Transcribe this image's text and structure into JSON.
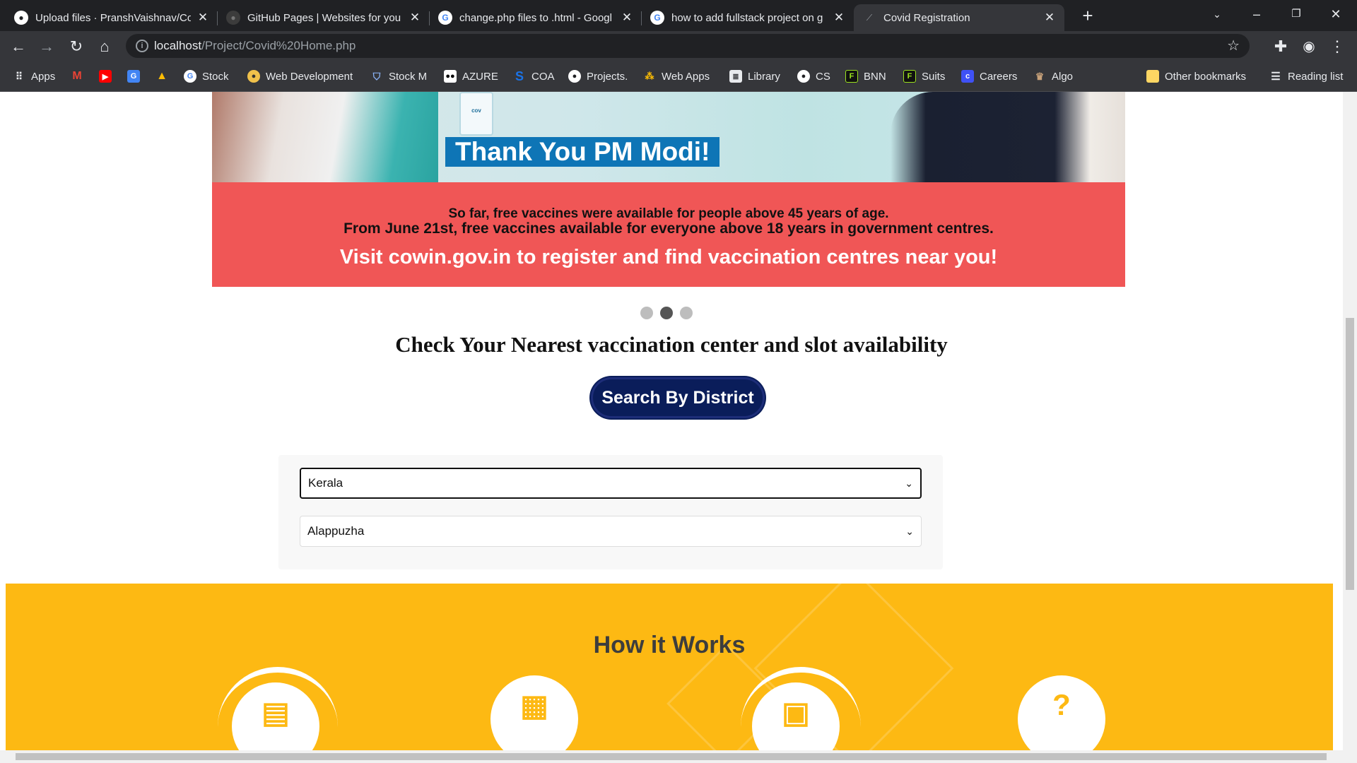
{
  "browser": {
    "tabs": [
      {
        "title": "Upload files · PranshVaishnav/Co",
        "icon": "github-icon"
      },
      {
        "title": "GitHub Pages | Websites for you",
        "icon": "github-icon"
      },
      {
        "title": "change.php files to .html - Googl",
        "icon": "google-icon"
      },
      {
        "title": "how to add fullstack project on g",
        "icon": "google-icon"
      },
      {
        "title": "Covid Registration",
        "icon": "page-icon"
      }
    ],
    "url_host": "localhost",
    "url_path": "/Project/Covid%20Home.php",
    "bookmarks": [
      "Apps",
      "Stock",
      "Web Development",
      "Stock M",
      "AZURE",
      "COA",
      "Projects.",
      "Web Apps",
      "Library",
      "CS",
      "BNN",
      "Suits",
      "Careers",
      "Algo"
    ],
    "other_bookmarks": "Other bookmarks",
    "reading_list": "Reading list"
  },
  "page": {
    "banner": {
      "thank_you": "Thank You PM Modi!",
      "line1": "So far, free vaccines were available for people above 45 years of age.",
      "line2": "From June 21st, free vaccines available for everyone above 18 years in government centres.",
      "line3": "Visit cowin.gov.in to register and find vaccination centres near you!",
      "vial_label": "cov"
    },
    "carousel_active_index": 2,
    "heading": "Check Your Nearest vaccination center and slot availability",
    "search_button": "Search By District",
    "state_select": "Kerala",
    "district_select": "Alappuzha",
    "how_it_works": "How it Works"
  },
  "colors": {
    "banner_red": "#f05656",
    "thank_blue": "#0e75b6",
    "button_navy": "#0a1d5a",
    "section_yellow": "#fdb913"
  }
}
